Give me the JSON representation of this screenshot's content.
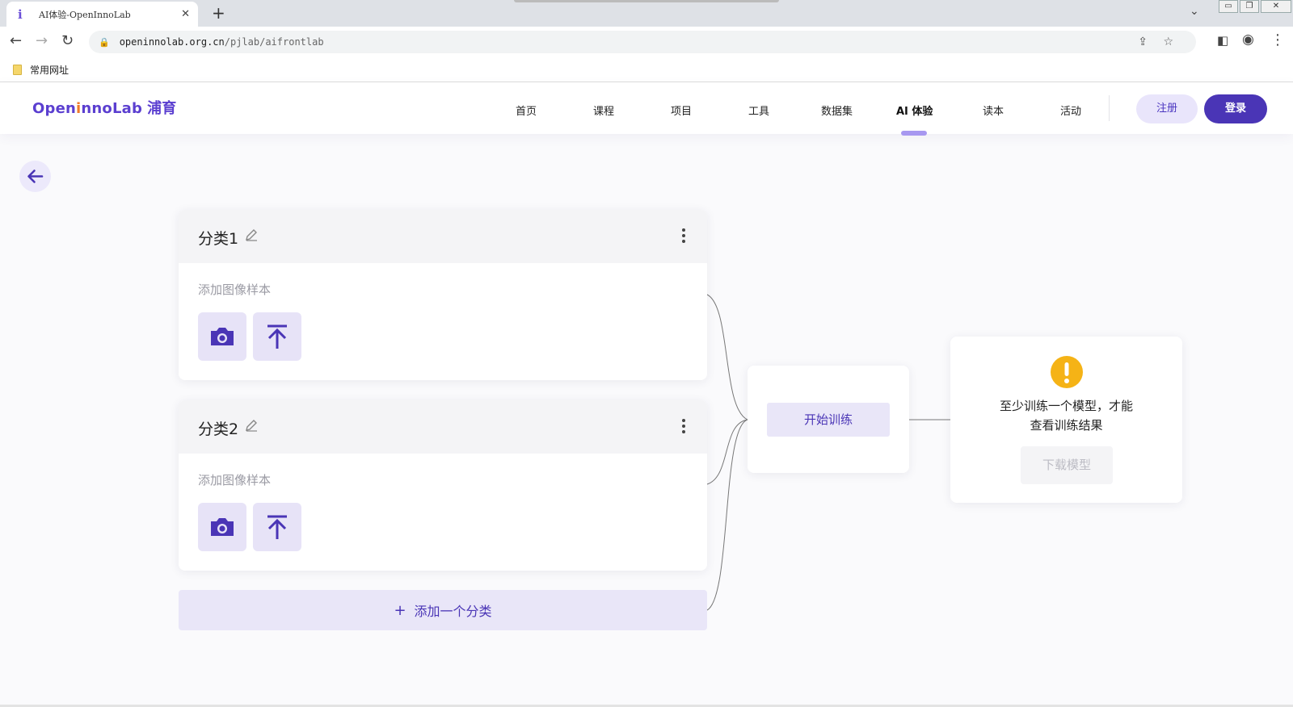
{
  "browser": {
    "tab_title": "AI体验-OpenInnoLab",
    "tab_favicon": "i",
    "tab_close": "✕",
    "new_tab": "+",
    "url_host": "openinnolab.org.cn",
    "url_path": "/pjlab/aifrontlab",
    "bookmark_label": "常用网址"
  },
  "header": {
    "logo_open": "Open",
    "logo_i": "i",
    "logo_nno": "nnoLab",
    "logo_cn": "浦育",
    "nav": [
      {
        "label": "首页"
      },
      {
        "label": "课程"
      },
      {
        "label": "项目"
      },
      {
        "label": "工具"
      },
      {
        "label": "数据集"
      },
      {
        "label": "AI 体验"
      },
      {
        "label": "读本"
      },
      {
        "label": "活动"
      }
    ],
    "active_nav": "AI 体验",
    "register_label": "注册",
    "login_label": "登录"
  },
  "classes": [
    {
      "title": "分类1",
      "hint": "添加图像样本"
    },
    {
      "title": "分类2",
      "hint": "添加图像样本"
    }
  ],
  "add_class_label": "添加一个分类",
  "add_class_plus": "+",
  "train": {
    "button_label": "开始训练"
  },
  "result": {
    "message_line1": "至少训练一个模型，才能",
    "message_line2": "查看训练结果",
    "download_label": "下载模型"
  },
  "colors": {
    "accent": "#4a35b6",
    "accent_light": "#e9e6f8",
    "warning": "#f5b316"
  }
}
